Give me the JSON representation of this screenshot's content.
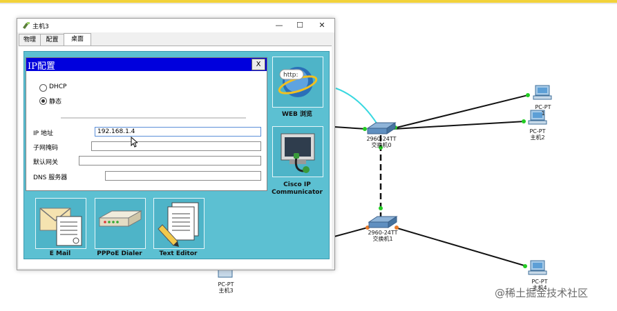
{
  "window": {
    "title": "主机3",
    "controls": {
      "minimize": "—",
      "maximize": "☐",
      "close": "✕"
    },
    "tabs": [
      "物理",
      "配置",
      "桌面"
    ],
    "active_tab": "桌面"
  },
  "ip_config": {
    "title": "IP配置",
    "close_label": "X",
    "mode_options": [
      {
        "label": "DHCP",
        "selected": false
      },
      {
        "label": "静态",
        "selected": true
      }
    ],
    "fields": {
      "ip_label": "IP 地址",
      "ip_value": "192.168.1.4",
      "mask_label": "子网掩码",
      "mask_value": "",
      "gateway_label": "默认网关",
      "gateway_value": "",
      "dns_label": "DNS 服务器",
      "dns_value": ""
    }
  },
  "desktop_apps": {
    "web": "WEB 浏览",
    "http_text": "http:",
    "cisco_ip_1": "Cisco IP",
    "cisco_ip_2": "Communicator",
    "email": "E Mail",
    "pppoe": "PPPoE Dialer",
    "text_editor": "Text Editor"
  },
  "topology": {
    "switch0_model": "2960-24TT",
    "switch0_name": "交换机0",
    "switch1_model": "2960-24TT",
    "switch1_name": "交换机1",
    "pc_top_model": "PC-PT",
    "pc_top_name": "1",
    "pc2_model": "PC-PT",
    "pc2_name": "主机2",
    "pc3_model": "PC-PT",
    "pc3_name": "主机3",
    "pc4_model": "PC-PT",
    "pc4_name": "主机4"
  },
  "watermark": "@稀土掘金技术社区",
  "colors": {
    "dialog_title_bg": "#0000dd",
    "desktop_bg": "#5cc0d2",
    "link_green": "#22cc22",
    "link_orange": "#e87a2a",
    "wireless_cyan": "#39d8e0"
  }
}
